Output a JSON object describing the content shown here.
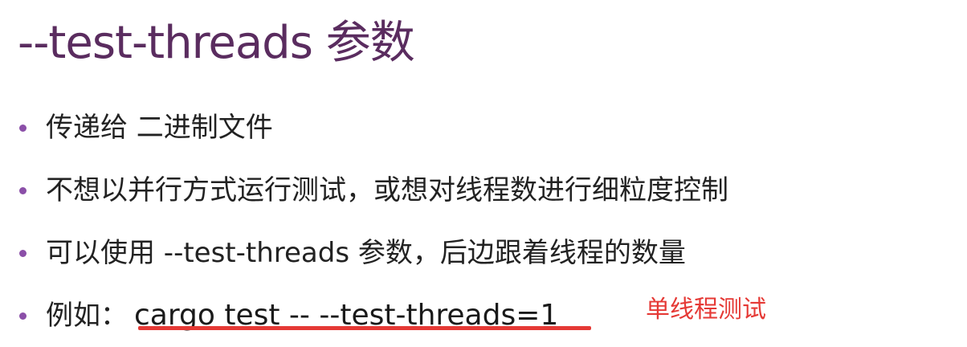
{
  "title": "--test-threads 参数",
  "bullets": [
    {
      "text": "传递给 二进制文件"
    },
    {
      "text": "不想以并行方式运行测试，或想对线程数进行细粒度控制"
    },
    {
      "text": "可以使用 --test-threads 参数，后边跟着线程的数量"
    },
    {
      "text": "例如：",
      "code": "cargo test -- --test-threads=1"
    }
  ],
  "annotation": "单线程测试",
  "colors": {
    "title": "#5a2c5f",
    "bullet": "#8b4fa8",
    "text": "#222222",
    "highlight": "#e53935"
  }
}
